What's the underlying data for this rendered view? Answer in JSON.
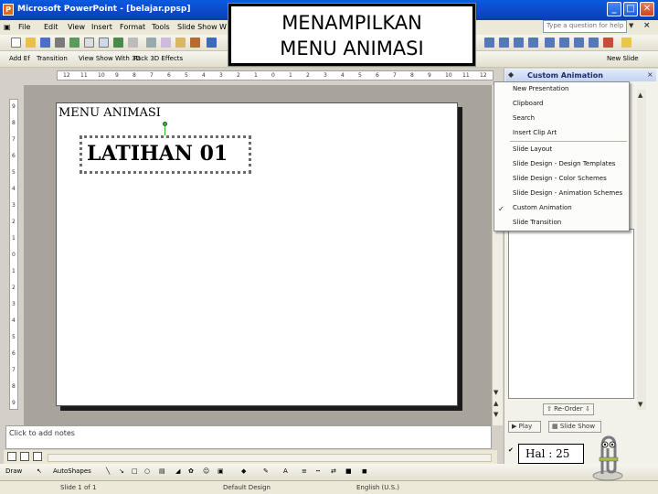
{
  "window": {
    "title": "Microsoft PowerPoint - [belajar.ppsp]",
    "minimize_glyph": "_",
    "maximize_glyph": "□",
    "close_glyph": "✕"
  },
  "menu": {
    "items": [
      "File",
      "Edit",
      "View",
      "Insert",
      "Format",
      "Tools",
      "Slide Show",
      "W"
    ],
    "help_placeholder": "Type a question for help",
    "help_arrow": "▼",
    "close_glyph": "×"
  },
  "toolbar_formatting": {
    "items": [
      "Add Ef",
      "Transition",
      "View Show With 3D",
      "Pack 3D Effects"
    ],
    "new_slide": "New Slide"
  },
  "ruler": {
    "h_ticks": [
      "12",
      "11",
      "10",
      "9",
      "8",
      "7",
      "6",
      "5",
      "4",
      "3",
      "2",
      "1",
      "0",
      "1",
      "2",
      "3",
      "4",
      "5",
      "6",
      "7",
      "8",
      "9",
      "10",
      "11",
      "12"
    ],
    "v_ticks": [
      "9",
      "8",
      "7",
      "6",
      "5",
      "4",
      "3",
      "2",
      "1",
      "0",
      "1",
      "2",
      "3",
      "4",
      "5",
      "6",
      "7",
      "8",
      "9"
    ]
  },
  "slide": {
    "title": "MENU ANIMASI",
    "placeholder_text": "LATIHAN 01"
  },
  "notes": {
    "placeholder": "Click to add notes"
  },
  "task_pane": {
    "title": "Custom Animation",
    "nav_back": "◆",
    "close_glyph": "×",
    "re_order": "Re-Order",
    "play": "Play",
    "slide_show": "Slide Show",
    "autopreview_check": "✔"
  },
  "task_pane_menu": {
    "items": [
      "New Presentation",
      "Clipboard",
      "Search",
      "Insert Clip Art",
      "Slide Layout",
      "Slide Design - Design Templates",
      "Slide Design - Color Schemes",
      "Slide Design - Animation Schemes",
      "Custom Animation",
      "Slide Transition"
    ],
    "checked_glyph": "✓"
  },
  "drawing": {
    "draw_label": "Draw",
    "autoshapes_label": "AutoShapes"
  },
  "status": {
    "slide": "Slide 1 of 1",
    "design": "Default Design",
    "language": "English (U.S.)"
  },
  "overlay": {
    "caption_line1": "MENAMPILKAN",
    "caption_line2": "MENU ANIMASI",
    "page_label": "Hal : 25"
  },
  "colors": {
    "title_bar": "#0b48c4",
    "accent_blue": "#1b2a6b",
    "workspace_gray": "#a8a49c"
  }
}
